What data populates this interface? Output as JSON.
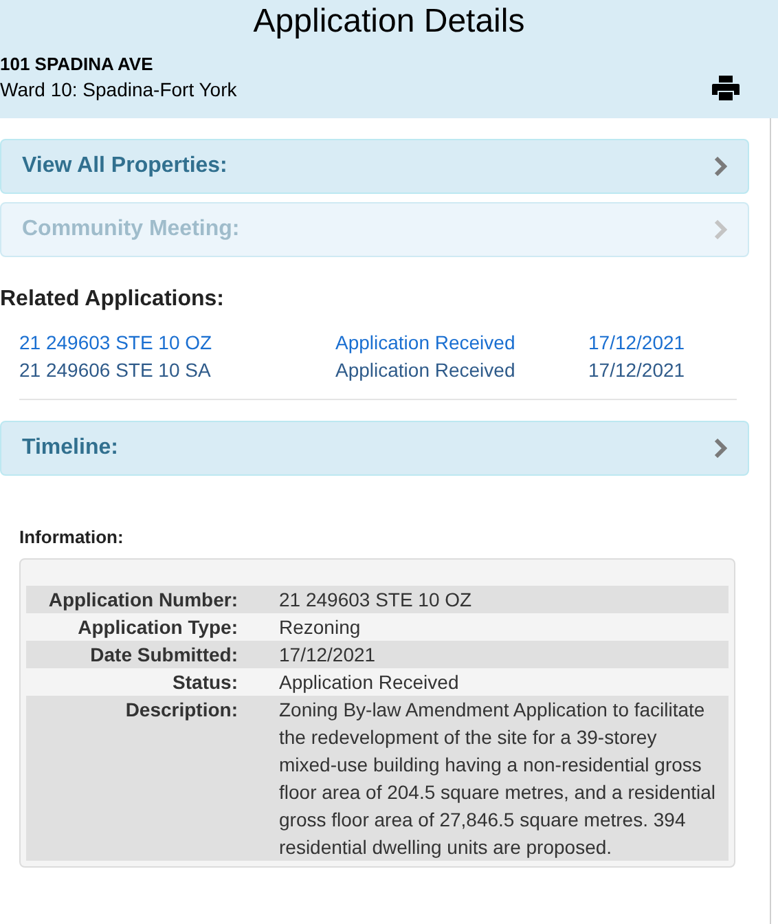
{
  "header": {
    "title": "Application Details",
    "address": "101 SPADINA AVE",
    "ward": "Ward 10: Spadina-Fort York"
  },
  "panels_top": [
    {
      "label": "View All Properties:",
      "disabled": false
    },
    {
      "label": "Community Meeting:",
      "disabled": true
    }
  ],
  "related": {
    "heading": "Related Applications:",
    "rows": [
      {
        "number": "21 249603 STE 10 OZ",
        "status": "Application Received",
        "date": "17/12/2021",
        "selected": true
      },
      {
        "number": "21 249606 STE 10 SA",
        "status": "Application Received",
        "date": "17/12/2021",
        "selected": false
      }
    ]
  },
  "panels_bottom": [
    {
      "label": "Timeline:",
      "disabled": false
    }
  ],
  "information": {
    "heading": "Information:",
    "rows": [
      {
        "label": "Application Number:",
        "value": "21 249603 STE 10 OZ"
      },
      {
        "label": "Application Type:",
        "value": "Rezoning"
      },
      {
        "label": "Date Submitted:",
        "value": "17/12/2021"
      },
      {
        "label": "Status:",
        "value": "Application Received"
      },
      {
        "label": "Description:",
        "value": "Zoning By-law Amendment Application to facilitate the redevelopment of the site for a 39-storey mixed-use building having a non-residential gross floor area of 204.5 square metres, and a residential gross floor area of 27,846.5 square metres. 394 residential dwelling units are proposed."
      }
    ]
  }
}
